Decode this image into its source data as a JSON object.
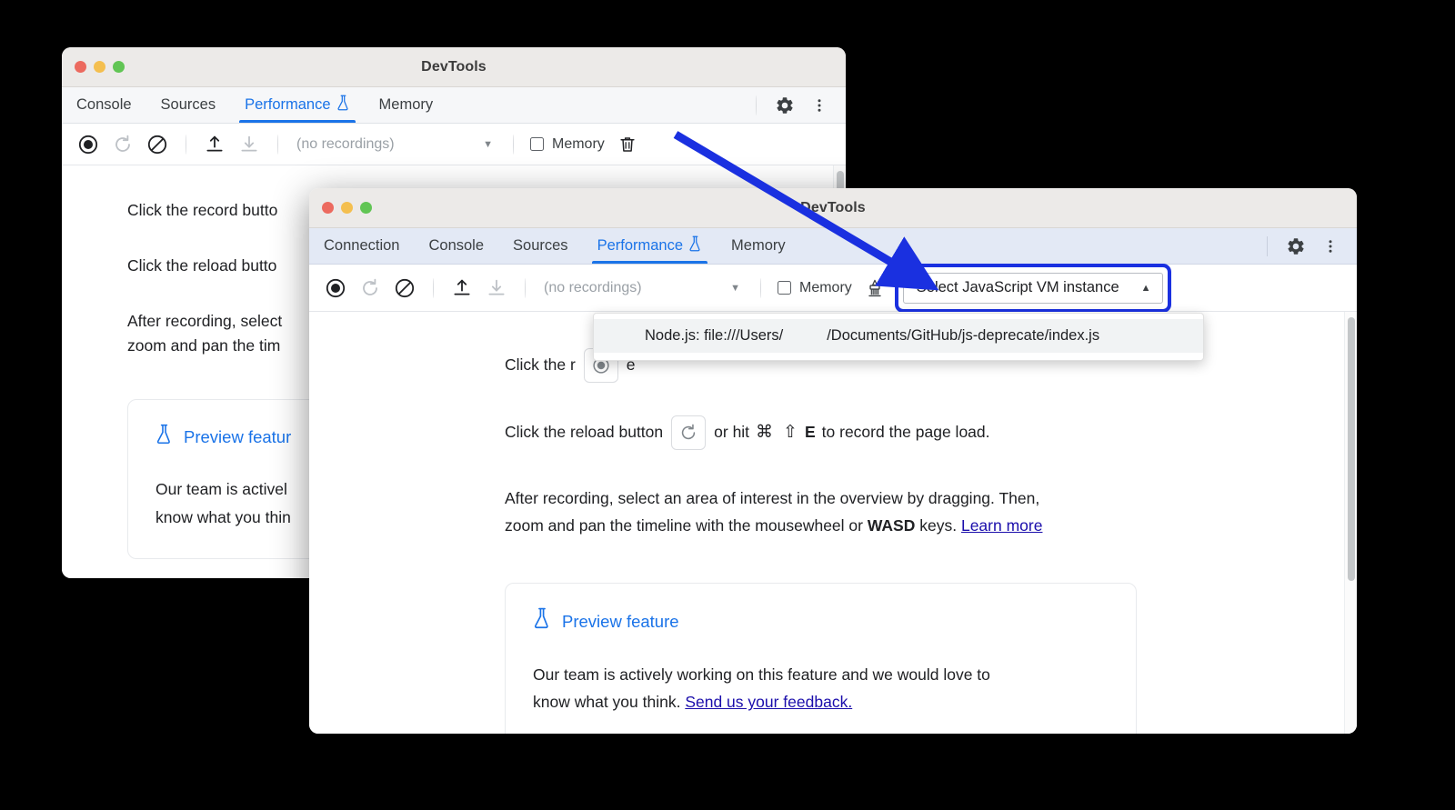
{
  "windows": {
    "back": {
      "title": "DevTools",
      "tabs": [
        {
          "label": "Console",
          "active": false,
          "flask": false
        },
        {
          "label": "Sources",
          "active": false,
          "flask": false
        },
        {
          "label": "Performance",
          "active": true,
          "flask": true
        },
        {
          "label": "Memory",
          "active": false,
          "flask": false
        }
      ],
      "toolbar": {
        "record_icon": "record-icon",
        "reload_icon": "reload-record-icon",
        "clear_icon": "clear-icon",
        "load_icon": "load-profile-icon",
        "save_icon": "save-profile-icon",
        "recordings_value": "(no recordings)",
        "recordings_caret": "▼",
        "memory_label": "Memory",
        "trash_icon": "trash-icon"
      },
      "header_right": {
        "settings_icon": "gear-icon",
        "more_icon": "more-vertical-icon"
      },
      "body": {
        "p1_pre": "Click the record butto",
        "p2_pre": "Click the reload butto",
        "p3_line1": "After recording, select",
        "p3_line2": "zoom and pan the tim",
        "preview_title": "Preview featur",
        "preview_line1": "Our team is activel",
        "preview_line2": "know what you thin"
      }
    },
    "front": {
      "title": "DevTools",
      "tabs": [
        {
          "label": "Connection",
          "active": false,
          "flask": false
        },
        {
          "label": "Console",
          "active": false,
          "flask": false
        },
        {
          "label": "Sources",
          "active": false,
          "flask": false
        },
        {
          "label": "Performance",
          "active": true,
          "flask": true
        },
        {
          "label": "Memory",
          "active": false,
          "flask": false
        }
      ],
      "toolbar": {
        "record_icon": "record-icon",
        "reload_icon": "reload-record-icon",
        "clear_icon": "clear-icon",
        "load_icon": "load-profile-icon",
        "save_icon": "save-profile-icon",
        "recordings_value": "(no recordings)",
        "recordings_caret": "▼",
        "memory_label": "Memory",
        "broom_icon": "collect-garbage-icon",
        "vm_button_label": "Select JavaScript VM instance",
        "vm_button_caret": "▲"
      },
      "header_right": {
        "settings_icon": "gear-icon",
        "more_icon": "more-vertical-icon"
      },
      "dropdown": {
        "item_left": "Node.js: file:///Users/",
        "item_right": "/Documents/GitHub/js-deprecate/index.js"
      },
      "body": {
        "p1_a": "Click the r",
        "p1_b": "e",
        "p2_a": "Click the reload button",
        "p2_b": "or hit",
        "p2_cmd": "⌘",
        "p2_shift": "⇧",
        "p2_key": "E",
        "p2_c": "to record the page load.",
        "p3_line1": "After recording, select an area of interest in the overview by dragging. Then,",
        "p3_line2a": "zoom and pan the timeline with the mousewheel or",
        "p3_wasd": "WASD",
        "p3_line2b": "keys.",
        "p3_link": "Learn more",
        "preview_title": "Preview feature",
        "preview_line1": "Our team is actively working on this feature and we would love to",
        "preview_line2a": "know what you think.",
        "preview_link": "Send us your feedback."
      }
    }
  },
  "annotation": {
    "arrow_name": "blue-pointer-arrow",
    "highlight_name": "blue-highlight-ring"
  },
  "colors": {
    "accent_blue": "#1a73e8",
    "annotation_blue": "#1a30e0",
    "tabstrip_blue": "#e3e9f5",
    "titlebar_gray": "#eceae8",
    "link_purple": "#1a0dab"
  }
}
